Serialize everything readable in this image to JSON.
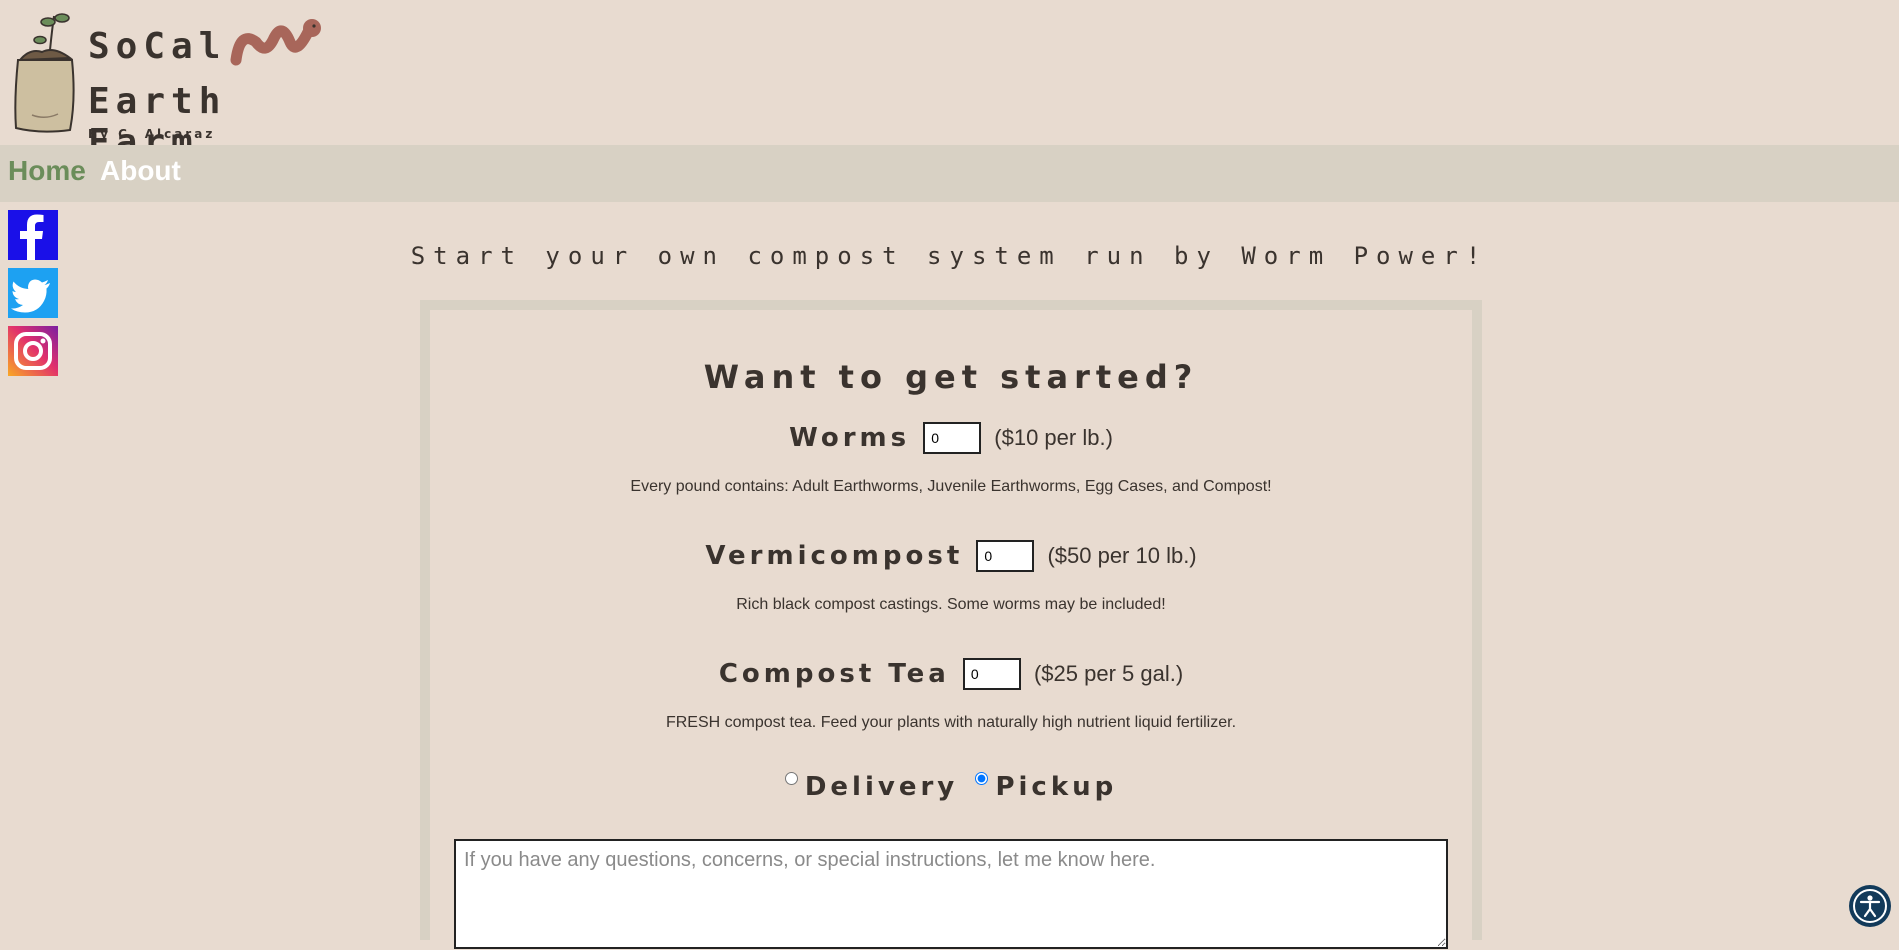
{
  "header": {
    "logo_line1": "SoCal",
    "logo_line2": "Earth Farm",
    "logo_line3": "By C. Alcaraz"
  },
  "nav": {
    "home": "Home",
    "about": "About"
  },
  "social": [
    "facebook-icon",
    "twitter-icon",
    "instagram-icon"
  ],
  "tagline": "Start your own compost system run by Worm Power!",
  "form": {
    "title": "Want to get started?",
    "products": [
      {
        "label": "Worms",
        "value": "0",
        "price": "($10 per lb.)",
        "description": "Every pound contains: Adult Earthworms, Juvenile Earthworms, Egg Cases, and Compost!"
      },
      {
        "label": "Vermicompost",
        "value": "0",
        "price": "($50 per 10 lb.)",
        "description": "Rich black compost castings. Some worms may be included!"
      },
      {
        "label": "Compost Tea",
        "value": "0",
        "price": "($25 per 5 gal.)",
        "description": "FRESH compost tea. Feed your plants with naturally high nutrient liquid fertilizer."
      }
    ],
    "delivery_label": "Delivery",
    "pickup_label": "Pickup",
    "selected_option": "Pickup",
    "notes_placeholder": "If you have any questions, concerns, or special instructions, let me know here."
  },
  "colors": {
    "background": "#e8dbd0",
    "nav_bar": "#d8d1c4",
    "home_link": "#6b8d5a",
    "about_link": "#ffffff",
    "facebook": "#1a10e8",
    "twitter": "#1da1f2"
  }
}
